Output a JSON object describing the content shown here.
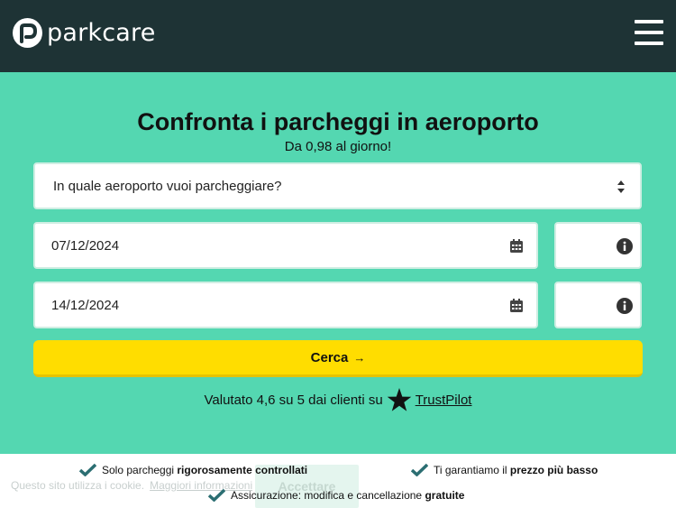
{
  "brand": {
    "name": "parkcare"
  },
  "colors": {
    "topbar": "#1e3335",
    "hero": "#54d7b1",
    "cta": "#ffdd00",
    "check": "#2b6e72"
  },
  "hero": {
    "title": "Confronta i parcheggi in aeroporto",
    "subtitle": "Da 0,98 al giorno!"
  },
  "form": {
    "airport_placeholder": "In quale aeroporto vuoi parcheggiare?",
    "date_start": "07/12/2024",
    "date_end": "14/12/2024",
    "time_start": "",
    "time_end": "",
    "search_label": "Cerca",
    "search_arrow": "→"
  },
  "rating": {
    "text": "Valutato 4,6 su 5 dai clienti su",
    "link": "TrustPilot"
  },
  "cookie": {
    "text": "Questo sito utilizza i cookie.",
    "more": "Maggiori informazioni",
    "accept": "Accettare"
  },
  "features": [
    {
      "prefix": "Solo parcheggi ",
      "bold": "rigorosamente controllati",
      "suffix": ""
    },
    {
      "prefix": "Ti garantiamo il ",
      "bold": "prezzo più basso",
      "suffix": ""
    },
    {
      "prefix": "Assicurazione: modifica e cancellazione ",
      "bold": "gratuite",
      "suffix": ""
    }
  ]
}
